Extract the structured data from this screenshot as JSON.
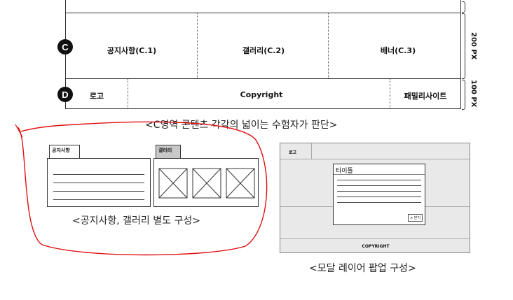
{
  "layout": {
    "row_c": {
      "marker": "C",
      "cells": [
        "공지사항(C.1)",
        "갤러리(C.2)",
        "배너(C.3)"
      ],
      "height": "200 PX"
    },
    "row_d": {
      "marker": "D",
      "cells": [
        "로고",
        "Copyright",
        "패밀리사이트"
      ],
      "height": "100 PX"
    },
    "caption": "<C영역 콘텐츠 각각의 넓이는 수험자가 판단>"
  },
  "separate": {
    "notice_tab": "공지사항",
    "gallery_tab": "갤러리",
    "caption": "<공지사항, 갤러리 별도 구성>"
  },
  "modal": {
    "logo": "로고",
    "title": "타이틀",
    "close": "× 닫기",
    "copyright": "COPYRIGHT",
    "caption": "<모달 레이어 팝업 구성>"
  },
  "colors": {
    "annotation": "#e01010",
    "tab_gray": "#c8c8c8",
    "mock_bg": "#e9e9e9"
  }
}
